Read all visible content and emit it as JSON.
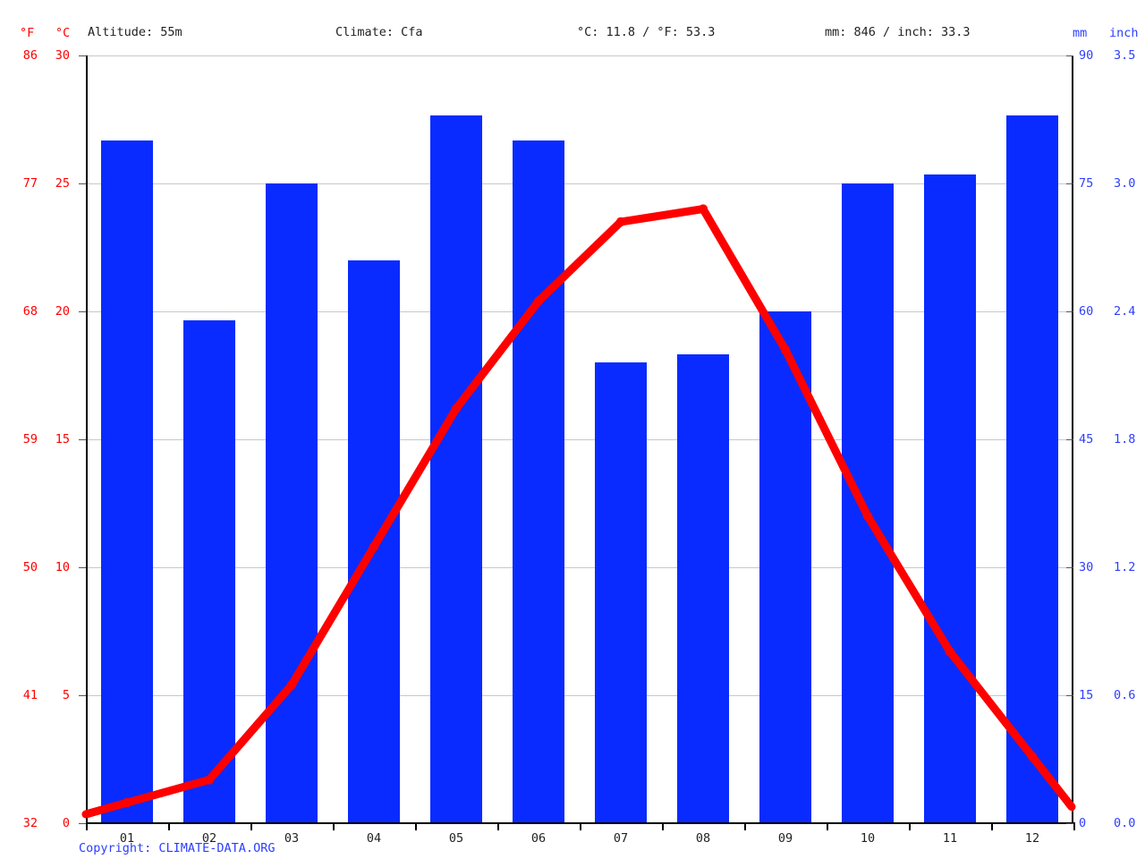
{
  "header": {
    "unit_f": "°F",
    "unit_c": "°C",
    "altitude": "Altitude: 55m",
    "climate": "Climate: Cfa",
    "temperature_summary": "°C: 11.8 / °F: 53.3",
    "precipitation_summary": "mm: 846 / inch: 33.3",
    "unit_mm": "mm",
    "unit_inch": "inch"
  },
  "footer": {
    "copyright": "Copyright: CLIMATE-DATA.ORG"
  },
  "colors": {
    "temperature_line": "#ff0000",
    "precipitation_bar": "#0a2bff",
    "left_axis_text": "#ff0000",
    "right_axis_text": "#2b3eff",
    "gridline": "#c8c8c8",
    "axis": "#000000"
  },
  "chart_data": {
    "type": "bar",
    "title": "",
    "subtitle": "",
    "xlabel": "",
    "categories": [
      "01",
      "02",
      "03",
      "04",
      "05",
      "06",
      "07",
      "08",
      "09",
      "10",
      "11",
      "12"
    ],
    "grid": true,
    "legend_position": "none",
    "axes": {
      "left_primary": {
        "name": "temperature_celsius",
        "label": "°C",
        "ticks": [
          30,
          25,
          20,
          15,
          10,
          5,
          0
        ],
        "range": [
          0,
          30
        ],
        "color": "#ff0000"
      },
      "left_secondary": {
        "name": "temperature_fahrenheit",
        "label": "°F",
        "ticks": [
          86,
          77,
          68,
          59,
          50,
          41,
          32
        ],
        "range": [
          32,
          86
        ],
        "color": "#ff0000"
      },
      "right_primary": {
        "name": "precipitation_mm",
        "label": "mm",
        "ticks": [
          90,
          75,
          60,
          45,
          30,
          15,
          0
        ],
        "range": [
          0,
          90
        ],
        "color": "#2b3eff"
      },
      "right_secondary": {
        "name": "precipitation_inch",
        "label": "inch",
        "ticks": [
          "3.5",
          "3.0",
          "2.4",
          "1.8",
          "1.2",
          "0.6",
          "0.0"
        ],
        "range": [
          0.0,
          3.5
        ],
        "color": "#2b3eff"
      }
    },
    "series": [
      {
        "name": "Precipitation",
        "type": "bar",
        "unit": "mm",
        "axis": "right",
        "color": "#0a2bff",
        "values": [
          80,
          59,
          75,
          66,
          83,
          80,
          54,
          55,
          60,
          75,
          76,
          83
        ]
      },
      {
        "name": "Temperature",
        "type": "line",
        "unit": "°C",
        "axis": "left",
        "color": "#ff0000",
        "values": [
          0.8,
          1.7,
          5.4,
          10.8,
          16.2,
          20.4,
          23.5,
          24.0,
          18.5,
          12.0,
          6.7,
          2.6
        ]
      }
    ]
  }
}
